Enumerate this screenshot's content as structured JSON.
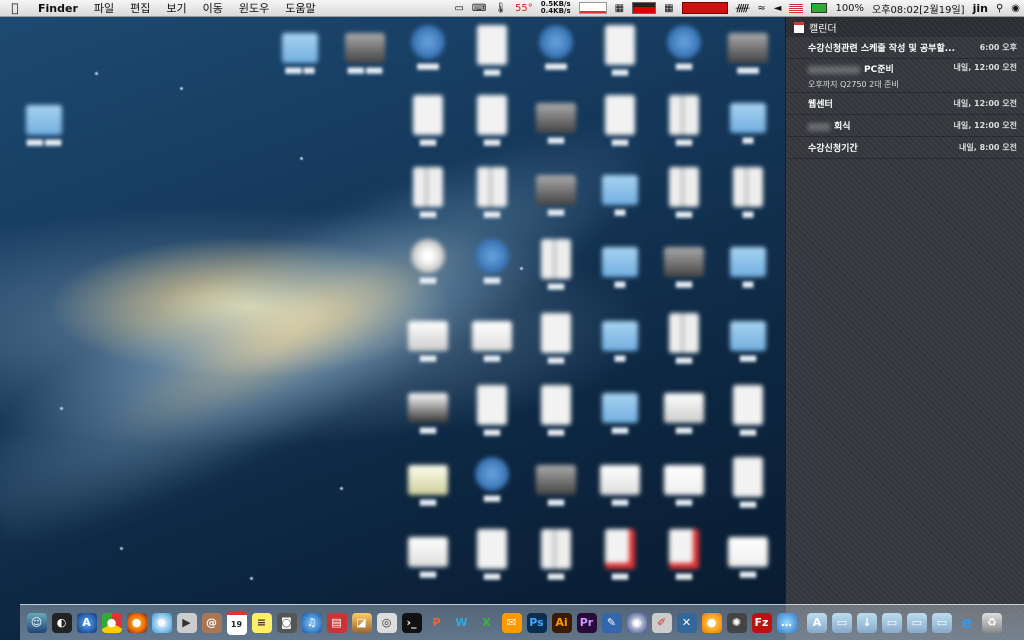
{
  "menubar": {
    "apple_icon": "apple-icon",
    "app_name": "Finder",
    "menus": [
      "파일",
      "편집",
      "보기",
      "이동",
      "윈도우",
      "도움말"
    ],
    "temperature": "55°",
    "net_up": "0.5KB/s",
    "net_down": "0.4KB/s",
    "battery": "100%",
    "clock": "오후08:02[2월19일]",
    "user": "jin"
  },
  "notification_center": {
    "section_title": "캘린더",
    "events": [
      {
        "title": "수강신청관련 스케줄 작성 및 공부할...",
        "time": "6:00 오후",
        "blurred_prefix": false
      },
      {
        "title": "PC준비",
        "time": "내일, 12:00 오전",
        "blurred_prefix": true,
        "subtitle": "오후까지 Q2750 2대 준비"
      },
      {
        "title": "웹센터",
        "time": "내일, 12:00 오전",
        "blurred_prefix": false
      },
      {
        "title": "회식",
        "time": "내일, 12:00 오전",
        "blurred_prefix": true
      },
      {
        "title": "수강신청기간",
        "time": "내일, 8:00 오전",
        "blurred_prefix": false
      }
    ]
  },
  "dock": {
    "apps": [
      "finder",
      "dashboard",
      "app-store",
      "chrome",
      "firefox",
      "safari",
      "facetime",
      "contacts",
      "calendar",
      "notes",
      "photo-booth",
      "itunes",
      "photo",
      "iphoto",
      "preview",
      "terminal",
      "powerpoint",
      "word",
      "excel",
      "outlook",
      "photoshop",
      "illustrator",
      "premiere",
      "xcode",
      "network",
      "instruments",
      "xcode-tools",
      "firefox-2",
      "utility",
      "filezilla",
      "messages",
      "applications-folder",
      "documents-folder",
      "downloads-folder",
      "folder-4",
      "folder-5",
      "folder-6",
      "internet-explorer",
      "trash"
    ],
    "calendar_day": "19"
  },
  "colors": {
    "accent_red": "#d32020",
    "panel_bg": "#3a3d42",
    "menubar_bg": "#e8e8e8"
  }
}
